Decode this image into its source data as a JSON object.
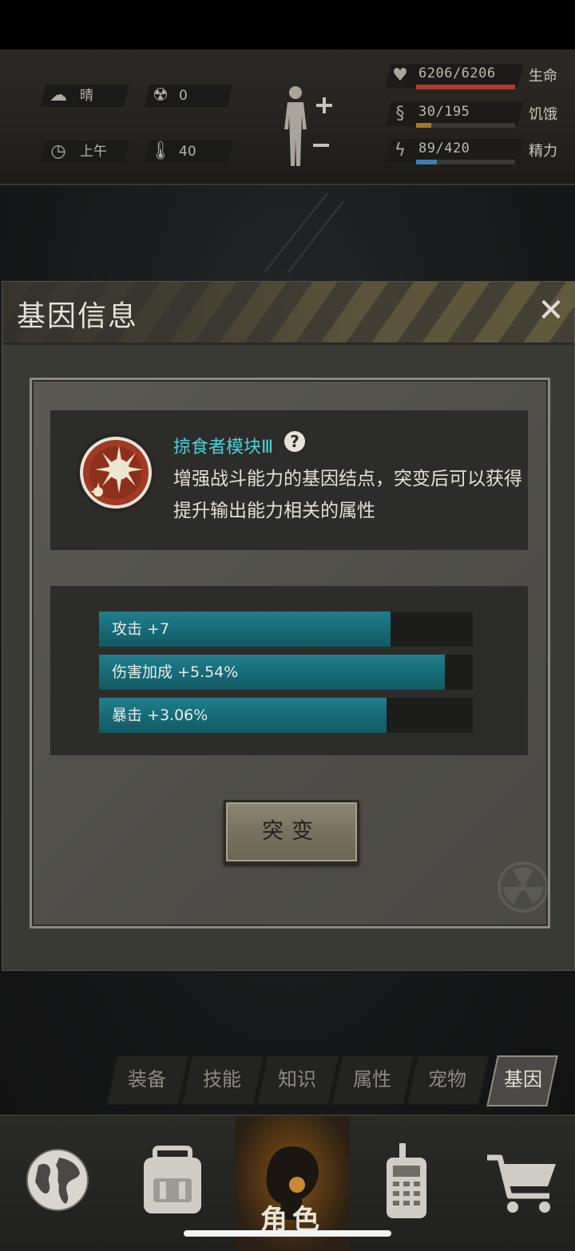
{
  "hud": {
    "weather": {
      "icon": "cloud-sun-icon",
      "label": "晴"
    },
    "radiation": {
      "icon": "radiation-icon",
      "value": "0"
    },
    "time": {
      "icon": "clock-icon",
      "label": "上午"
    },
    "temperature": {
      "icon": "thermometer-icon",
      "value": "40"
    },
    "body_icon": "human-body-icon",
    "stats": [
      {
        "name": "生命",
        "value": "6206/6206",
        "fraction": 1.0,
        "color": "#b33a2e",
        "icon": "heart-pulse-icon"
      },
      {
        "name": "饥饿",
        "value": "30/195",
        "fraction": 0.154,
        "color": "#a57a2a",
        "icon": "stomach-icon"
      },
      {
        "name": "精力",
        "value": "89/420",
        "fraction": 0.212,
        "color": "#3a7fb3",
        "icon": "energy-head-icon"
      }
    ]
  },
  "modal": {
    "title": "基因信息",
    "close_icon": "close-icon",
    "gene": {
      "name": "掠食者模块Ⅲ",
      "help_glyph": "?",
      "description": "增强战斗能力的基因结点，突变后可以获得提升输出能力相关的属性",
      "badge_icon": "spiky-virus-icon"
    },
    "stats": [
      {
        "label": "攻击 +7",
        "fraction": 0.78
      },
      {
        "label": "伤害加成 +5.54%",
        "fraction": 0.925
      },
      {
        "label": "暴击 +3.06%",
        "fraction": 0.77
      }
    ],
    "mutate_label": "突变"
  },
  "tabs": [
    {
      "label": "装备",
      "active": false
    },
    {
      "label": "技能",
      "active": false
    },
    {
      "label": "知识",
      "active": false
    },
    {
      "label": "属性",
      "active": false
    },
    {
      "label": "宠物",
      "active": false
    },
    {
      "label": "基因",
      "active": true
    }
  ],
  "nav": [
    {
      "icon": "globe-icon",
      "label": "",
      "active": false
    },
    {
      "icon": "backpack-icon",
      "label": "",
      "active": false
    },
    {
      "icon": "character-head-icon",
      "label": "角色",
      "active": true
    },
    {
      "icon": "radio-icon",
      "label": "",
      "active": false
    },
    {
      "icon": "shopping-cart-icon",
      "label": "",
      "active": false
    }
  ]
}
